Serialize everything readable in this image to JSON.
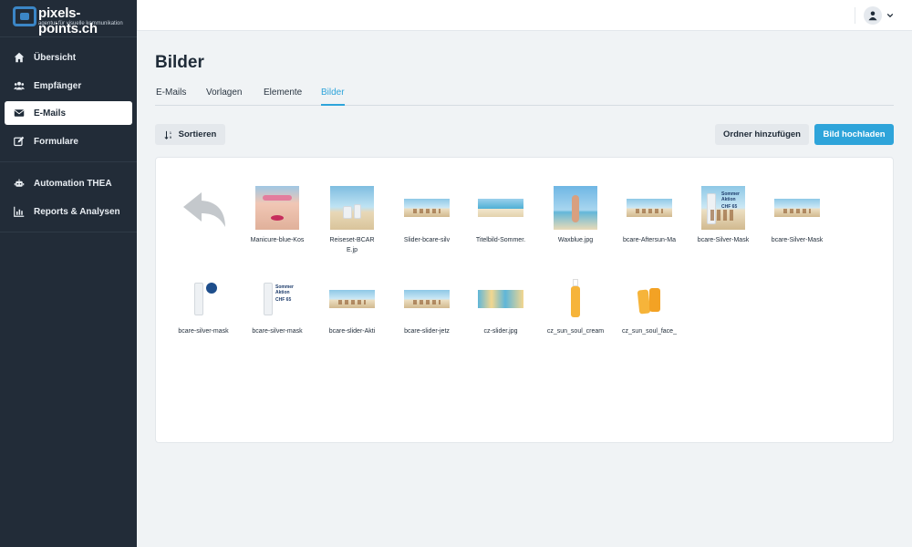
{
  "brand": {
    "name": "pixels-points.ch",
    "tagline": "agentur für visuelle kommunikation"
  },
  "sidebar": {
    "items": [
      {
        "label": "Übersicht",
        "icon": "home-icon"
      },
      {
        "label": "Empfänger",
        "icon": "users-icon"
      },
      {
        "label": "E-Mails",
        "icon": "envelope-icon",
        "active": true
      },
      {
        "label": "Formulare",
        "icon": "edit-icon"
      },
      {
        "label": "Automation THEA",
        "icon": "robot-icon"
      },
      {
        "label": "Reports & Analysen",
        "icon": "bar-chart-icon"
      }
    ]
  },
  "header": {
    "user_icon": "user-icon",
    "menu_icon": "chevron-down-icon"
  },
  "page": {
    "title": "Bilder",
    "tabs": [
      {
        "label": "E-Mails"
      },
      {
        "label": "Vorlagen"
      },
      {
        "label": "Elemente"
      },
      {
        "label": "Bilder",
        "active": true
      }
    ]
  },
  "toolbar": {
    "sort_label": "Sortieren",
    "add_folder_label": "Ordner hinzufügen",
    "upload_label": "Bild hochladen"
  },
  "gallery": {
    "back_icon": "back-arrow-icon",
    "images": [
      {
        "caption": "Manicure-blue-Kos"
      },
      {
        "caption": "Reiseset-BCARE.jp"
      },
      {
        "caption": "Slider-bcare-silv"
      },
      {
        "caption": "Titelbild-Sommer."
      },
      {
        "caption": "Waxblue.jpg"
      },
      {
        "caption": "bcare-Aftersun-Ma"
      },
      {
        "caption": "bcare-Silver-Mask"
      },
      {
        "caption": "bcare-Silver-Mask"
      },
      {
        "caption": "bcare-silver-mask"
      },
      {
        "caption": "bcare-silver-mask"
      },
      {
        "caption": "bcare-slider-Akti"
      },
      {
        "caption": "bcare-slider-jetz"
      },
      {
        "caption": "cz-slider.jpg"
      },
      {
        "caption": "cz_sun_soul_cream"
      },
      {
        "caption": "cz_sun_soul_face_"
      }
    ],
    "thumb_text": {
      "sommer": "Sommer",
      "aktion": "Aktion",
      "chf": "CHF 65"
    }
  },
  "colors": {
    "sidebar_bg": "#222c38",
    "accent": "#2ea4da",
    "page_bg": "#f0f3f5"
  }
}
